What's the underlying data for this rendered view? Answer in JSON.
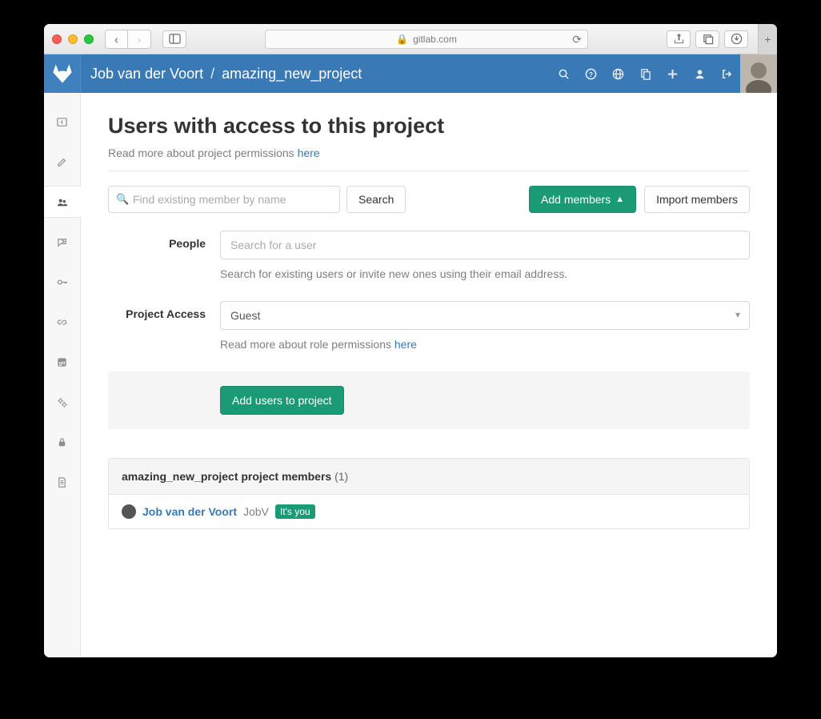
{
  "browser": {
    "domain": "gitlab.com"
  },
  "breadcrumb": {
    "owner": "Job van der Voort",
    "project": "amazing_new_project"
  },
  "page": {
    "title": "Users with access to this project",
    "subtitle_prefix": "Read more about project permissions ",
    "subtitle_link": "here"
  },
  "search": {
    "placeholder": "Find existing member by name",
    "button": "Search"
  },
  "actions": {
    "add_members": "Add members",
    "import_members": "Import members"
  },
  "form": {
    "people_label": "People",
    "people_placeholder": "Search for a user",
    "people_helper": "Search for existing users or invite new ones using their email address.",
    "access_label": "Project Access",
    "access_value": "Guest",
    "access_helper_prefix": "Read more about role permissions ",
    "access_helper_link": "here",
    "submit": "Add users to project"
  },
  "members": {
    "heading_prefix": "amazing_new_project project members ",
    "count": "(1)",
    "list": [
      {
        "name": "Job van der Voort",
        "handle": "JobV",
        "you_badge": "It's you"
      }
    ]
  }
}
